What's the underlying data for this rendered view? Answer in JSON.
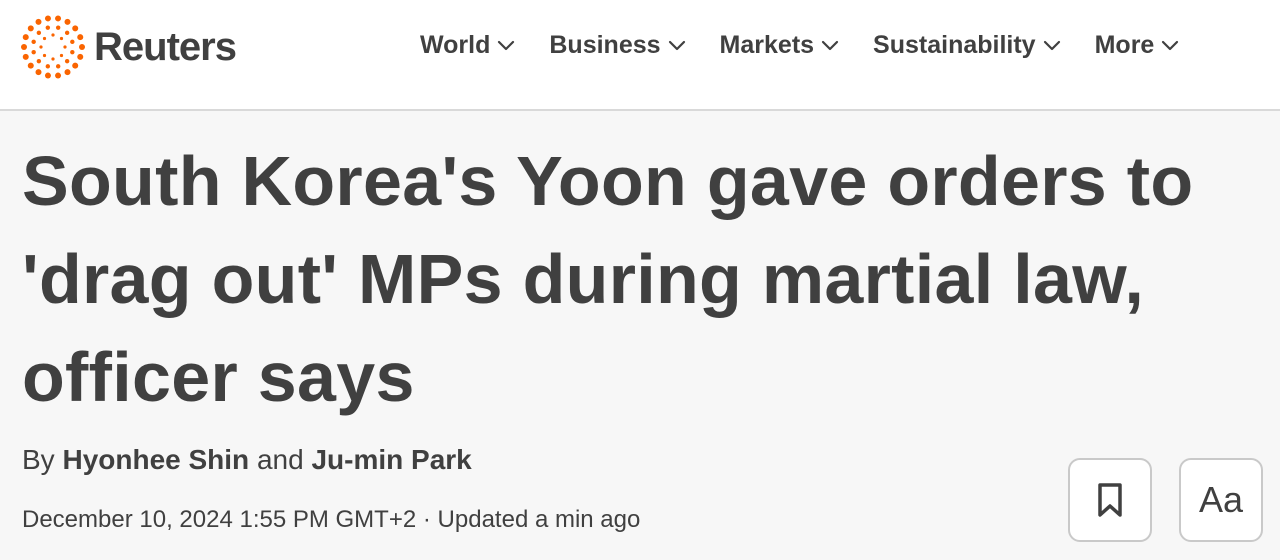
{
  "header": {
    "brand": "Reuters",
    "brand_color": "#fa6400",
    "nav": [
      {
        "label": "World",
        "icon": "chevron-down-icon"
      },
      {
        "label": "Business",
        "icon": "chevron-down-icon"
      },
      {
        "label": "Markets",
        "icon": "chevron-down-icon"
      },
      {
        "label": "Sustainability",
        "icon": "chevron-down-icon"
      },
      {
        "label": "More",
        "icon": "chevron-down-icon"
      }
    ]
  },
  "article": {
    "headline": "South Korea's Yoon gave orders to 'drag out' MPs during martial law, officer says",
    "byline": {
      "prefix": "By",
      "author1": "Hyonhee Shin",
      "conjunction": "and",
      "author2": "Ju-min Park"
    },
    "date": "December 10, 2024 1:55 PM GMT+2",
    "separator": "·",
    "updated": "Updated a min ago"
  },
  "actions": {
    "bookmark_icon": "bookmark-icon",
    "text_size_label": "Aa"
  }
}
